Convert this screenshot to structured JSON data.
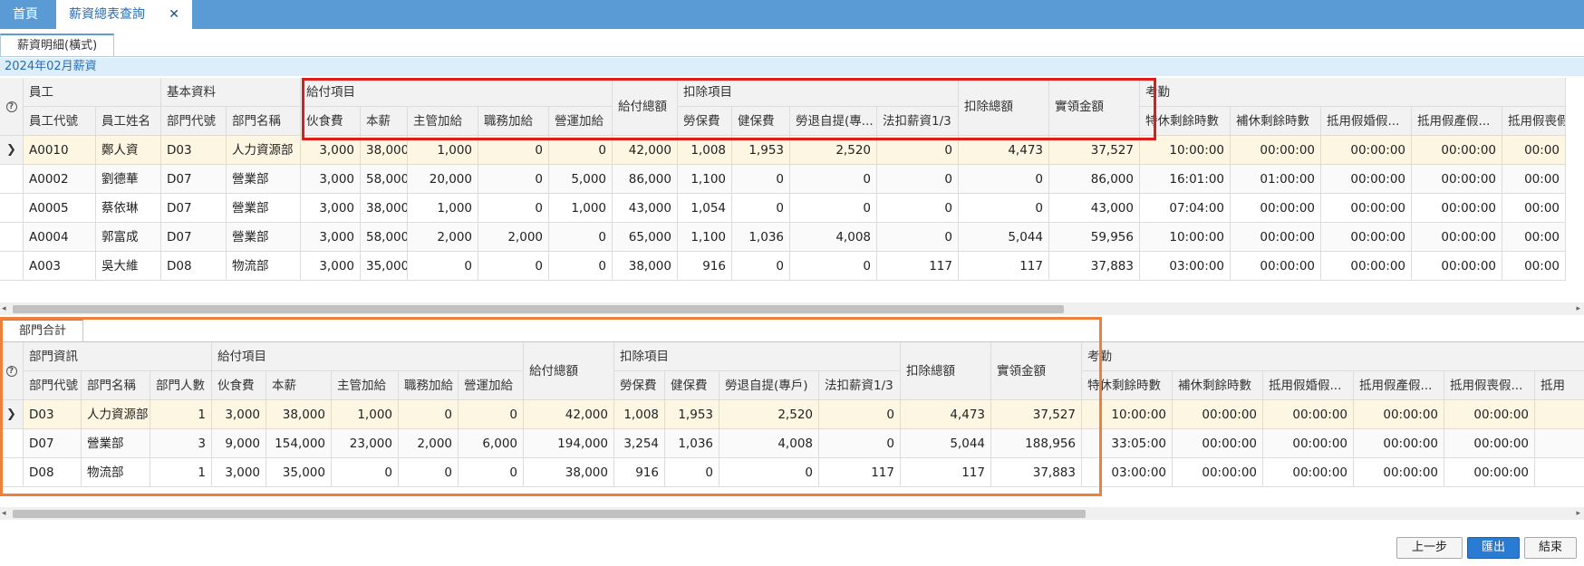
{
  "tabs": {
    "home": "首頁",
    "active": "薪資總表查詢"
  },
  "subtabs": {
    "detail": "薪資明細(橫式)",
    "dept": "部門合計"
  },
  "period": "2024年02月薪資",
  "detail": {
    "groups": [
      "員工",
      "基本資料",
      "給付項目",
      "給付總額",
      "扣除項目",
      "扣除總額",
      "實領金額",
      "考勤"
    ],
    "columns": [
      "員工代號",
      "員工姓名",
      "部門代號",
      "部門名稱",
      "伙食費",
      "本薪",
      "主管加給",
      "職務加給",
      "營運加給",
      "勞保費",
      "健保費",
      "勞退自提(專...",
      "法扣薪資1/3",
      "特休剩餘時數",
      "補休剩餘時數",
      "抵用假婚假...",
      "抵用假產假...",
      "抵用假喪假..."
    ],
    "rows": [
      [
        "A0010",
        "鄭人資",
        "D03",
        "人力資源部",
        "3,000",
        "38,000",
        "1,000",
        "0",
        "0",
        "42,000",
        "1,008",
        "1,953",
        "2,520",
        "0",
        "4,473",
        "37,527",
        "10:00:00",
        "00:00:00",
        "00:00:00",
        "00:00:00",
        "00:00"
      ],
      [
        "A0002",
        "劉德華",
        "D07",
        "營業部",
        "3,000",
        "58,000",
        "20,000",
        "0",
        "5,000",
        "86,000",
        "1,100",
        "0",
        "0",
        "0",
        "0",
        "86,000",
        "16:01:00",
        "01:00:00",
        "00:00:00",
        "00:00:00",
        "00:00"
      ],
      [
        "A0005",
        "蔡依琳",
        "D07",
        "營業部",
        "3,000",
        "38,000",
        "1,000",
        "0",
        "1,000",
        "43,000",
        "1,054",
        "0",
        "0",
        "0",
        "0",
        "43,000",
        "07:04:00",
        "00:00:00",
        "00:00:00",
        "00:00:00",
        "00:00"
      ],
      [
        "A0004",
        "郭富成",
        "D07",
        "營業部",
        "3,000",
        "58,000",
        "2,000",
        "2,000",
        "0",
        "65,000",
        "1,100",
        "1,036",
        "4,008",
        "0",
        "5,044",
        "59,956",
        "10:00:00",
        "00:00:00",
        "00:00:00",
        "00:00:00",
        "00:00"
      ],
      [
        "A003",
        "吳大維",
        "D08",
        "物流部",
        "3,000",
        "35,000",
        "0",
        "0",
        "0",
        "38,000",
        "916",
        "0",
        "0",
        "117",
        "117",
        "37,883",
        "03:00:00",
        "00:00:00",
        "00:00:00",
        "00:00:00",
        "00:00"
      ]
    ]
  },
  "dept": {
    "groups": [
      "部門資訊",
      "給付項目",
      "給付總額",
      "扣除項目",
      "扣除總額",
      "實領金額",
      "考勤"
    ],
    "columns": [
      "部門代號",
      "部門名稱",
      "部門人數",
      "伙食費",
      "本薪",
      "主管加給",
      "職務加給",
      "營運加給",
      "勞保費",
      "健保費",
      "勞退自提(專戶)",
      "法扣薪資1/3",
      "特休剩餘時數",
      "補休剩餘時數",
      "抵用假婚假...",
      "抵用假產假...",
      "抵用假喪假...",
      "抵用"
    ],
    "rows": [
      [
        "D03",
        "人力資源部",
        "1",
        "3,000",
        "38,000",
        "1,000",
        "0",
        "0",
        "42,000",
        "1,008",
        "1,953",
        "2,520",
        "0",
        "4,473",
        "37,527",
        "10:00:00",
        "00:00:00",
        "00:00:00",
        "00:00:00",
        "00:00:00",
        ""
      ],
      [
        "D07",
        "營業部",
        "3",
        "9,000",
        "154,000",
        "23,000",
        "2,000",
        "6,000",
        "194,000",
        "3,254",
        "1,036",
        "4,008",
        "0",
        "5,044",
        "188,956",
        "33:05:00",
        "00:00:00",
        "00:00:00",
        "00:00:00",
        "00:00:00",
        ""
      ],
      [
        "D08",
        "物流部",
        "1",
        "3,000",
        "35,000",
        "0",
        "0",
        "0",
        "38,000",
        "916",
        "0",
        "0",
        "117",
        "117",
        "37,883",
        "03:00:00",
        "00:00:00",
        "00:00:00",
        "00:00:00",
        "00:00:00",
        ""
      ]
    ]
  },
  "buttons": {
    "prev": "上一步",
    "export": "匯出",
    "finish": "結束"
  },
  "icons": {
    "help": "?",
    "row_indicator": "❯",
    "close": "✕",
    "scroll_left": "◂",
    "scroll_right": "▸"
  },
  "colors": {
    "accent": "#5b9bd5",
    "highlight_red": "#e01b1b",
    "highlight_orange": "#f07f3c"
  }
}
